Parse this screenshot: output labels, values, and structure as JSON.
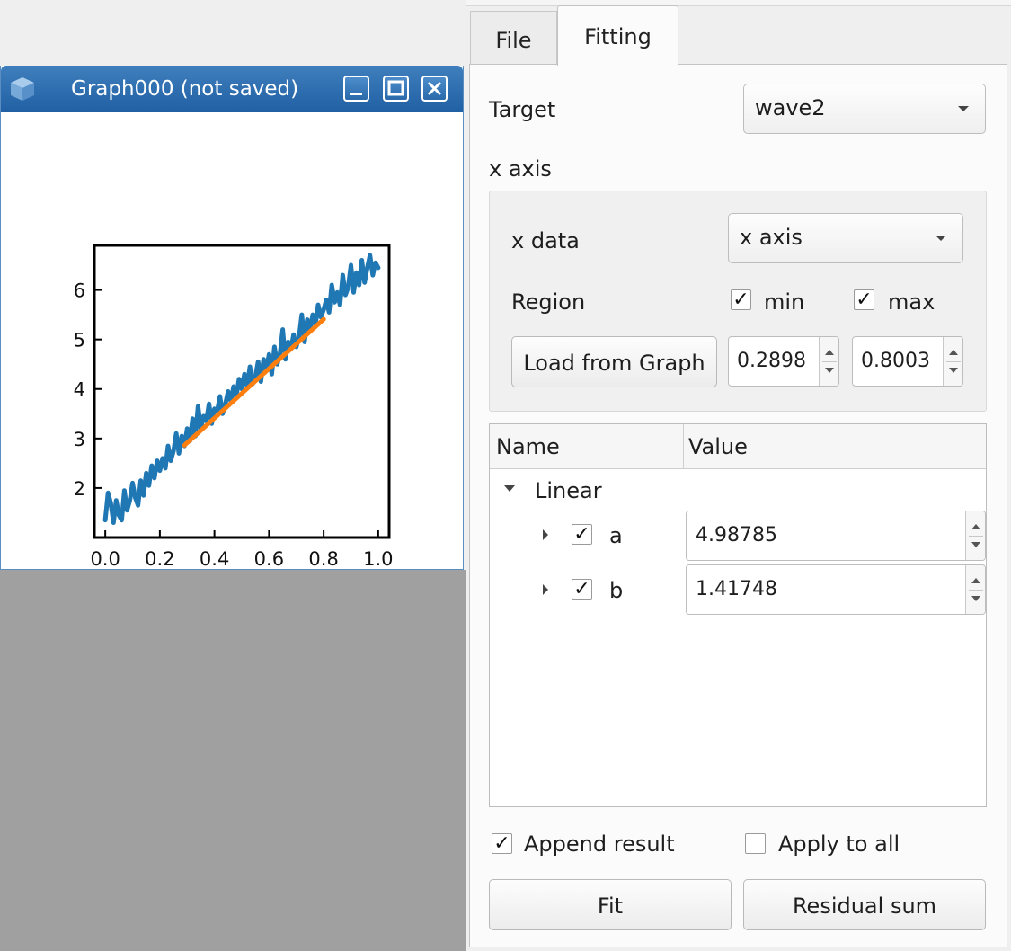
{
  "graph_window": {
    "title": "Graph000 (not saved)",
    "app_icon": "cube-app-icon",
    "buttons": {
      "minimize": "minimize-icon",
      "maximize": "maximize-icon",
      "close": "close-icon"
    }
  },
  "chart_data": {
    "type": "line",
    "xlim": [
      -0.04,
      1.04
    ],
    "ylim": [
      1.0,
      6.9
    ],
    "xticks": [
      "0.0",
      "0.2",
      "0.4",
      "0.6",
      "0.8",
      "1.0"
    ],
    "yticks": [
      "2",
      "3",
      "4",
      "5",
      "6"
    ],
    "grid": false,
    "series": [
      {
        "color": "#1f77b4",
        "x": [
          0.0,
          0.01,
          0.02,
          0.03,
          0.04,
          0.05,
          0.06,
          0.07,
          0.08,
          0.09,
          0.1,
          0.11,
          0.12,
          0.13,
          0.14,
          0.15,
          0.16,
          0.17,
          0.18,
          0.19,
          0.2,
          0.21,
          0.22,
          0.23,
          0.24,
          0.25,
          0.26,
          0.27,
          0.28,
          0.29,
          0.3,
          0.31,
          0.32,
          0.33,
          0.34,
          0.35,
          0.36,
          0.37,
          0.38,
          0.39,
          0.4,
          0.41,
          0.42,
          0.43,
          0.44,
          0.45,
          0.46,
          0.47,
          0.48,
          0.49,
          0.5,
          0.51,
          0.52,
          0.53,
          0.54,
          0.55,
          0.56,
          0.57,
          0.58,
          0.59,
          0.6,
          0.61,
          0.62,
          0.63,
          0.64,
          0.65,
          0.66,
          0.67,
          0.68,
          0.69,
          0.7,
          0.71,
          0.72,
          0.73,
          0.74,
          0.75,
          0.76,
          0.77,
          0.78,
          0.79,
          0.8,
          0.81,
          0.82,
          0.83,
          0.84,
          0.85,
          0.86,
          0.87,
          0.88,
          0.89,
          0.9,
          0.91,
          0.92,
          0.93,
          0.94,
          0.95,
          0.96,
          0.97,
          0.98,
          0.99,
          1.0
        ],
        "y": [
          1.35,
          1.9,
          1.7,
          1.3,
          1.75,
          1.45,
          1.35,
          1.95,
          1.55,
          1.75,
          2.1,
          1.8,
          1.65,
          2.15,
          1.85,
          2.3,
          2.05,
          2.45,
          2.2,
          2.55,
          2.35,
          2.6,
          2.4,
          2.85,
          2.55,
          2.75,
          3.1,
          2.7,
          3.05,
          2.85,
          3.2,
          2.95,
          3.4,
          3.05,
          3.65,
          3.2,
          3.45,
          3.35,
          3.7,
          3.3,
          3.6,
          3.55,
          3.85,
          3.5,
          3.7,
          3.95,
          3.75,
          4.05,
          3.85,
          4.2,
          4.0,
          4.3,
          4.05,
          4.45,
          4.1,
          4.25,
          4.55,
          4.15,
          4.6,
          4.4,
          4.7,
          4.3,
          4.85,
          4.5,
          4.7,
          5.2,
          4.6,
          4.95,
          4.8,
          5.1,
          4.85,
          5.05,
          5.5,
          4.95,
          5.4,
          5.2,
          5.5,
          5.3,
          5.7,
          5.45,
          5.6,
          5.8,
          5.55,
          6.1,
          5.75,
          5.95,
          5.7,
          6.3,
          5.9,
          6.05,
          6.5,
          5.95,
          6.35,
          6.1,
          6.6,
          6.15,
          6.45,
          6.7,
          6.3,
          6.55,
          6.45
        ]
      },
      {
        "color": "#ff7f0e",
        "x": [
          0.2898,
          0.8003
        ],
        "y": [
          2.863,
          5.41
        ]
      }
    ]
  },
  "tabs": {
    "file": "File",
    "fitting": "Fitting"
  },
  "target": {
    "label": "Target",
    "value": "wave2"
  },
  "x_axis": {
    "section_label": "x axis",
    "x_data_label": "x data",
    "x_data_value": "x axis",
    "region_label": "Region",
    "min_label": "min",
    "max_label": "max",
    "min_checked": true,
    "max_checked": true,
    "load_button": "Load from Graph",
    "min_value": "0.2898",
    "max_value": "0.8003"
  },
  "params_table": {
    "col_name": "Name",
    "col_value": "Value",
    "group": "Linear",
    "rows": [
      {
        "name": "a",
        "checked": true,
        "value": "4.98785"
      },
      {
        "name": "b",
        "checked": true,
        "value": "1.41748"
      }
    ]
  },
  "options": {
    "append_result": "Append result",
    "append_checked": true,
    "apply_to_all": "Apply to all",
    "apply_checked": false
  },
  "buttons": {
    "fit": "Fit",
    "residual": "Residual sum"
  },
  "check_glyph": "✓",
  "colors": {
    "title_bar": "#2b6cae",
    "mdi_background": "#a0a0a0",
    "data_line": "#1f77b4",
    "fit_line": "#ff7f0e"
  }
}
